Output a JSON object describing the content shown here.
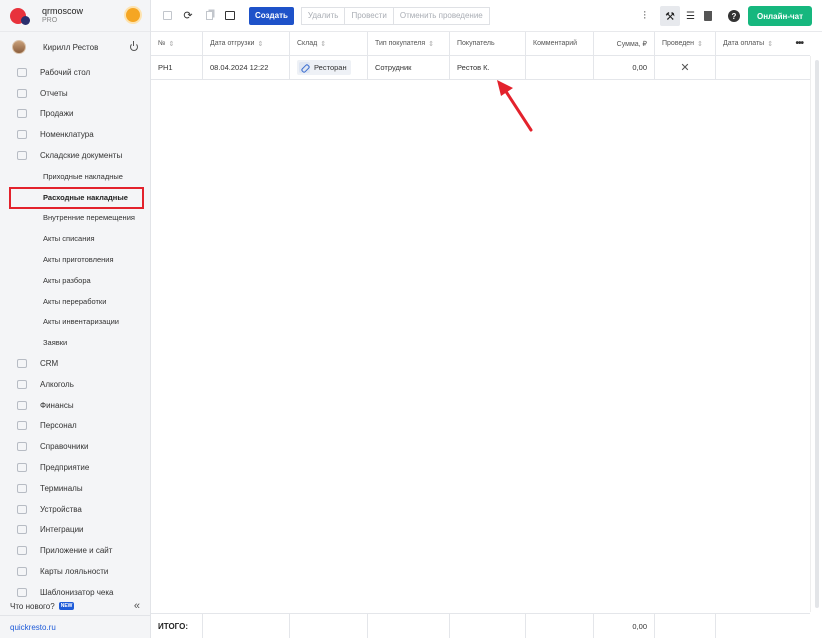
{
  "brand": {
    "name": "qrmoscow",
    "plan": "PRO"
  },
  "user": {
    "name": "Кирилл Рестов"
  },
  "menu": [
    {
      "label": "Рабочий стол",
      "icon": "gauge-icon"
    },
    {
      "label": "Отчеты",
      "icon": "chart-icon"
    },
    {
      "label": "Продажи",
      "icon": "basket-icon"
    },
    {
      "label": "Номенклатура",
      "icon": "tag-icon"
    },
    {
      "label": "Складские документы",
      "icon": "folder-icon"
    }
  ],
  "submenu": [
    {
      "label": "Приходные накладные"
    },
    {
      "label": "Расходные накладные",
      "active": true
    },
    {
      "label": "Внутренние перемещения"
    },
    {
      "label": "Акты списания"
    },
    {
      "label": "Акты приготовления"
    },
    {
      "label": "Акты разбора"
    },
    {
      "label": "Акты переработки"
    },
    {
      "label": "Акты инвентаризации"
    },
    {
      "label": "Заявки"
    }
  ],
  "menu2": [
    {
      "label": "CRM"
    },
    {
      "label": "Алкоголь"
    },
    {
      "label": "Финансы"
    },
    {
      "label": "Персонал"
    },
    {
      "label": "Справочники"
    },
    {
      "label": "Предприятие"
    },
    {
      "label": "Терминалы"
    },
    {
      "label": "Устройства"
    },
    {
      "label": "Интеграции"
    },
    {
      "label": "Приложение и сайт"
    },
    {
      "label": "Карты лояльности"
    },
    {
      "label": "Шаблонизатор чека"
    }
  ],
  "footer_links": {
    "whatsnew": "Что нового?",
    "new_badge": "NEW",
    "collapse": "«",
    "site": "quickresto.ru"
  },
  "toolbar": {
    "create": "Создать",
    "delete": "Удалить",
    "post": "Провести",
    "unpost": "Отменить проведение",
    "chat": "Онлайн-чат",
    "help": "?"
  },
  "table": {
    "columns": [
      "№",
      "Дата отгрузки",
      "Склад",
      "Тип покупателя",
      "Покупатель",
      "Комментарий",
      "Сумма, ₽",
      "Проведен",
      "Дата оплаты"
    ],
    "rows": [
      {
        "num": "РН1",
        "date": "08.04.2024 12:22",
        "store": "Ресторан",
        "buyer_type": "Сотрудник",
        "buyer": "Рестов К.",
        "comment": "",
        "sum": "0,00",
        "posted": "✕",
        "paid_date": ""
      }
    ],
    "total_label": "ИТОГО:",
    "total_sum": "0,00"
  },
  "colors": {
    "accent": "#1e52c9",
    "chat": "#16b77e",
    "highlight": "#e3222c"
  }
}
